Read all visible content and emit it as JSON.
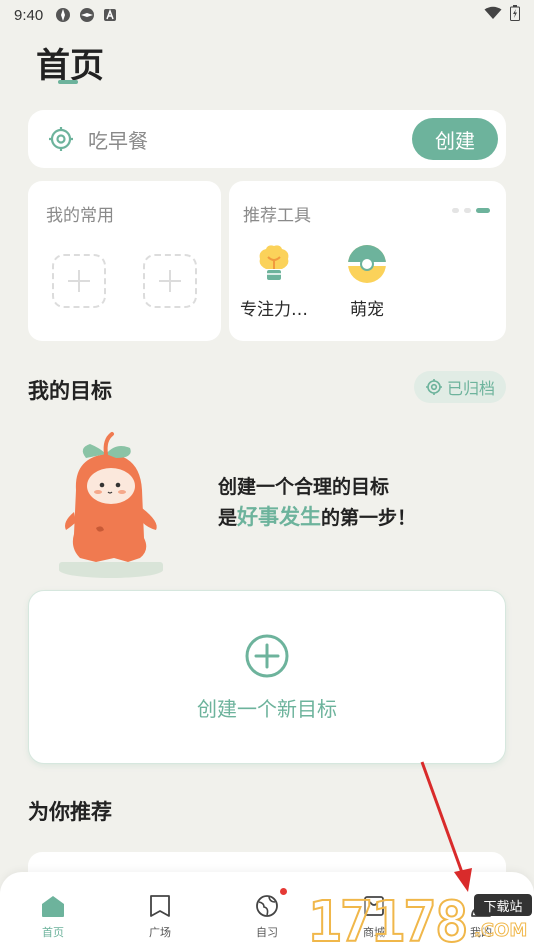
{
  "status_bar": {
    "time": "9:40"
  },
  "page": {
    "title": "首页"
  },
  "quick_create": {
    "placeholder": "吃早餐",
    "button_label": "创建"
  },
  "favorites": {
    "label": "我的常用"
  },
  "tools": {
    "label": "推荐工具",
    "items": [
      {
        "label": "专注力…",
        "icon": "lightbulb-icon"
      },
      {
        "label": "萌宠",
        "icon": "pet-ball-icon"
      }
    ]
  },
  "goals": {
    "title": "我的目标",
    "archived_label": "已归档",
    "motto_line1": "创建一个合理的目标",
    "motto_prefix": "是",
    "motto_highlight": "好事发生",
    "motto_suffix": "的第一步！",
    "new_goal_label": "创建一个新目标"
  },
  "recommend": {
    "title": "为你推荐"
  },
  "tabbar": {
    "items": [
      {
        "label": "首页",
        "icon": "home-icon",
        "active": true
      },
      {
        "label": "广场",
        "icon": "book-icon",
        "active": false
      },
      {
        "label": "自习",
        "icon": "globe-icon",
        "active": false,
        "badge": true
      },
      {
        "label": "商城",
        "icon": "shop-icon",
        "active": false
      },
      {
        "label": "我的",
        "icon": "person-icon",
        "active": false
      }
    ]
  },
  "watermark": {
    "digits": "17178",
    "badge": "下载站",
    "suffix": ".COM"
  },
  "colors": {
    "accent": "#6db39c",
    "background": "#f1f1ec",
    "badge": "#e53935"
  }
}
